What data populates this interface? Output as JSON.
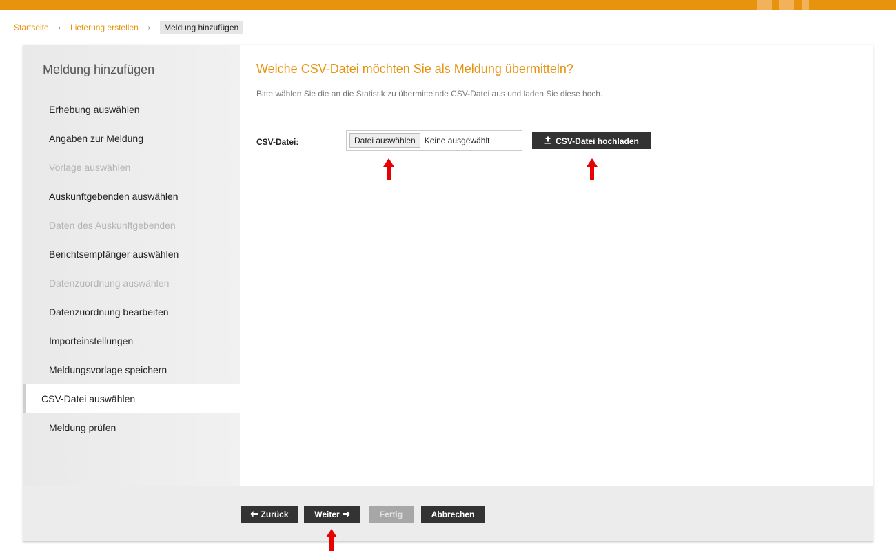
{
  "breadcrumb": {
    "home": "Startseite",
    "delivery": "Lieferung erstellen",
    "current": "Meldung hinzufügen",
    "separator": "›"
  },
  "sidebar": {
    "title": "Meldung hinzufügen",
    "steps": [
      {
        "label": "Erhebung auswählen",
        "state": "enabled"
      },
      {
        "label": "Angaben zur Meldung",
        "state": "enabled"
      },
      {
        "label": "Vorlage auswählen",
        "state": "disabled"
      },
      {
        "label": "Auskunftgebenden auswählen",
        "state": "enabled"
      },
      {
        "label": "Daten des Auskunftgebenden",
        "state": "disabled"
      },
      {
        "label": "Berichtsempfänger auswählen",
        "state": "enabled"
      },
      {
        "label": "Datenzuordnung auswählen",
        "state": "disabled"
      },
      {
        "label": "Datenzuordnung bearbeiten",
        "state": "enabled"
      },
      {
        "label": "Importeinstellungen",
        "state": "enabled"
      },
      {
        "label": "Meldungsvorlage speichern",
        "state": "enabled"
      },
      {
        "label": "CSV-Datei auswählen",
        "state": "active"
      },
      {
        "label": "Meldung prüfen",
        "state": "enabled"
      }
    ]
  },
  "content": {
    "question": "Welche CSV-Datei möchten Sie als Meldung übermitteln?",
    "description": "Bitte wählen Sie die an die Statistik zu übermittelnde CSV-Datei aus und laden Sie diese hoch.",
    "file_label": "CSV-Datei:",
    "file_button": "Datei auswählen",
    "file_status": "Keine ausgewählt",
    "upload_button": "CSV-Datei hochladen",
    "upload_icon": "upload-icon"
  },
  "footer": {
    "back": "Zurück",
    "next": "Weiter",
    "finish": "Fertig",
    "cancel": "Abbrechen"
  },
  "colors": {
    "accent": "#e8930e",
    "dark_button": "#333333",
    "disabled_button": "#a7a7a7",
    "annotation_arrow": "#e60000"
  }
}
